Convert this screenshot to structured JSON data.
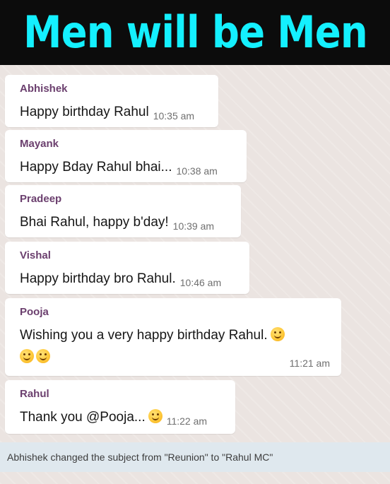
{
  "banner": {
    "title": "Men will be Men"
  },
  "messages": [
    {
      "sender": "Abhishek",
      "text": "Happy birthday Rahul",
      "time": "10:35 am"
    },
    {
      "sender": "Mayank",
      "text": "Happy Bday Rahul bhai...",
      "time": "10:38 am"
    },
    {
      "sender": "Pradeep",
      "text": "Bhai Rahul, happy b'day!",
      "time": "10:39 am"
    },
    {
      "sender": "Vishal",
      "text": "Happy birthday bro Rahul.",
      "time": "10:46 am"
    },
    {
      "sender": "Pooja",
      "text": "Wishing you a very happy birthday Rahul.",
      "time": "11:21 am",
      "emojis": [
        "smiling-face-emoji",
        "smiling-face-emoji",
        "smiling-face-emoji"
      ]
    },
    {
      "sender": "Rahul",
      "text": "Thank you @Pooja...",
      "time": "11:22 am",
      "emojis": [
        "smiling-face-emoji"
      ]
    }
  ],
  "system_message": "Abhishek changed the subject from \"Reunion\" to \"Rahul MC\"",
  "colors": {
    "banner_background": "#0c0c0c",
    "banner_text": "#14f0ff",
    "sender_name": "#6b3f6e",
    "bubble": "#ffffff",
    "chat_background": "#ebe4e1",
    "system_band": "#dfe8ee"
  }
}
